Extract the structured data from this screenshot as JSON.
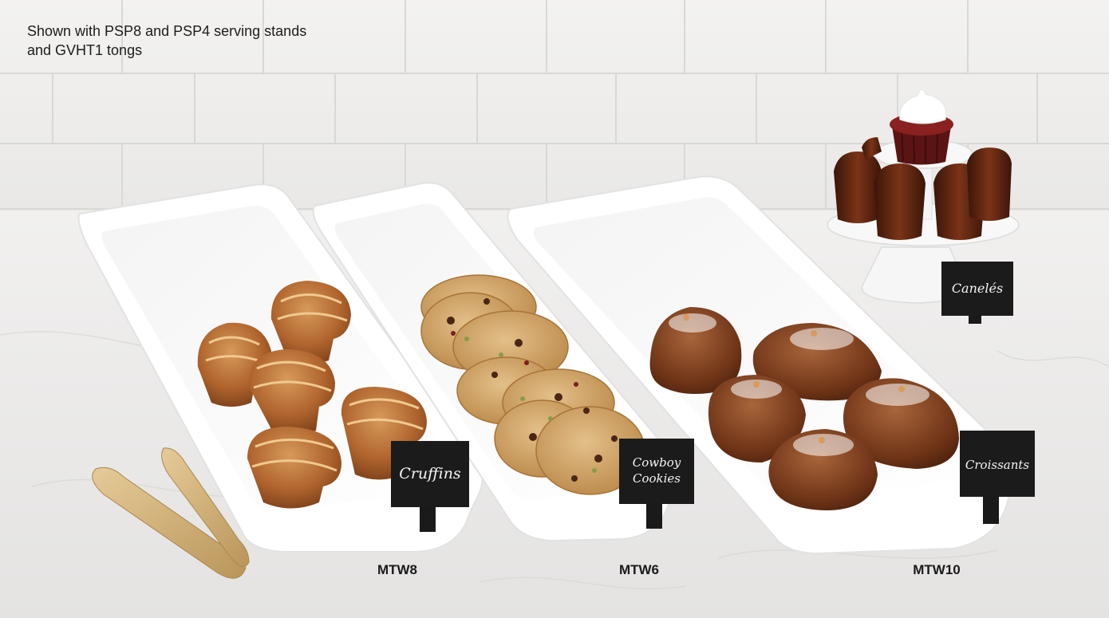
{
  "caption": {
    "line1": "Shown with PSP8 and PSP4 serving stands",
    "line2": "and GVHT1 tongs"
  },
  "labels": {
    "cruffins": "Cruffins",
    "cowboy_line1": "Cowboy",
    "cowboy_line2": "Cookies",
    "croissants": "Croissants",
    "caneles": "Canelés"
  },
  "skus": {
    "mtw8": "MTW8",
    "mtw6": "MTW6",
    "mtw10": "MTW10"
  },
  "colors": {
    "wall": "#f0efed",
    "counter": "#ecebea",
    "tray": "#ffffff",
    "chalkboard": "#1b1b1b",
    "tongs": "#d2b27c"
  }
}
